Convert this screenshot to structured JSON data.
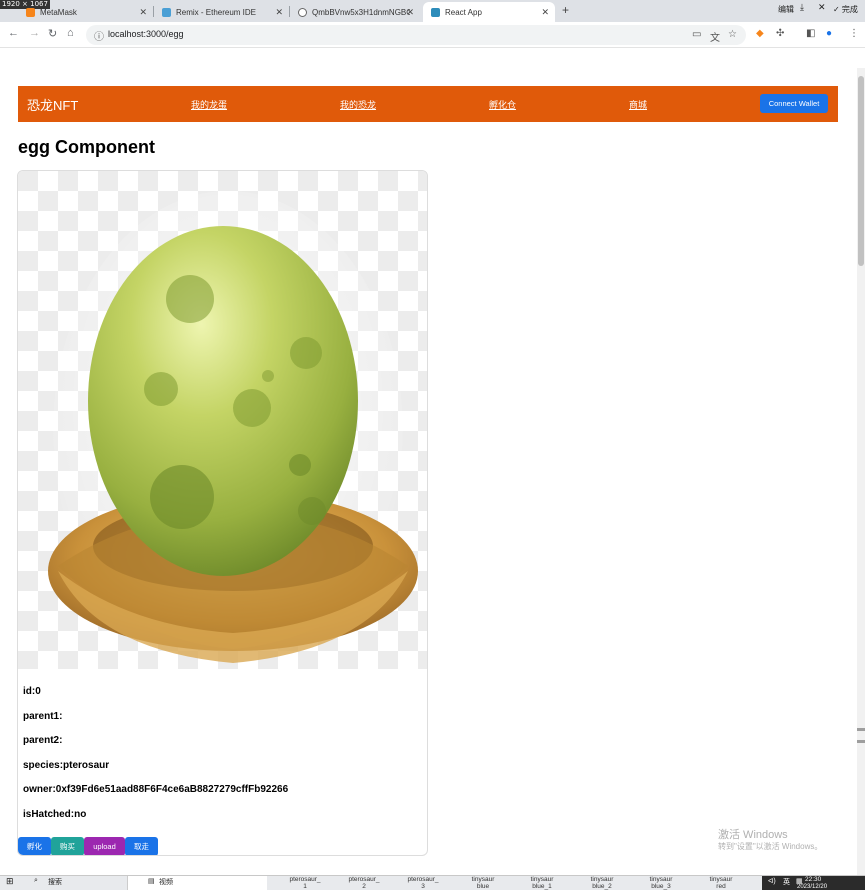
{
  "browser": {
    "resolution_badge": "1920 × 1067",
    "tabs": [
      {
        "label": "MetaMask",
        "color": "#f6851b",
        "active": false
      },
      {
        "label": "Remix - Ethereum IDE",
        "color": "#4a9fd5",
        "active": false
      },
      {
        "label": "QmbBVnw5x3H1dnmNGBC…",
        "color": "#666666",
        "active": false
      },
      {
        "label": "React App",
        "color": "#2d8cba",
        "active": true
      }
    ],
    "window_controls": [
      "编辑",
      "⤓",
      "✕",
      "✓ 完成"
    ],
    "url": "localhost:3000/egg"
  },
  "navbar": {
    "brand": "恐龙NFT",
    "links": [
      "我的龙蛋",
      "我的恐龙",
      "孵化仓",
      "商城"
    ],
    "connect_label": "Connect Wallet",
    "bg_color": "#e05a0a"
  },
  "page": {
    "heading": "egg Component"
  },
  "egg": {
    "id_line": "id:0",
    "parent1_line": "parent1:",
    "parent2_line": "parent2:",
    "species_line": "species:pterosaur",
    "owner_line": "owner:0xf39Fd6e51aad88F6F4ce6aB8827279cffFb92266",
    "hatched_line": "isHatched:no"
  },
  "actions": [
    {
      "label": "孵化",
      "color": "#1a73e8"
    },
    {
      "label": "购买",
      "color": "#20a39a"
    },
    {
      "label": "upload",
      "color": "#9c27b0"
    },
    {
      "label": "取走",
      "color": "#1a73e8"
    }
  ],
  "watermark": {
    "line1": "激活 Windows",
    "line2": "转到\"设置\"以激活 Windows。"
  },
  "taskbar": {
    "search_label": "搜索",
    "app_label": "视频",
    "files": [
      {
        "line1": "pterosaur_",
        "line2": "1"
      },
      {
        "line1": "pterosaur_",
        "line2": "2"
      },
      {
        "line1": "pterosaur_",
        "line2": "3"
      },
      {
        "line1": "tinysaur",
        "line2": "blue"
      },
      {
        "line1": "tinysaur",
        "line2": "blue_1"
      },
      {
        "line1": "tinysaur",
        "line2": "blue_2"
      },
      {
        "line1": "tinysaur",
        "line2": "blue_3"
      },
      {
        "line1": "tinysaur",
        "line2": "red"
      }
    ],
    "ime": "英",
    "time": "22:30",
    "date": "2023/12/20"
  }
}
